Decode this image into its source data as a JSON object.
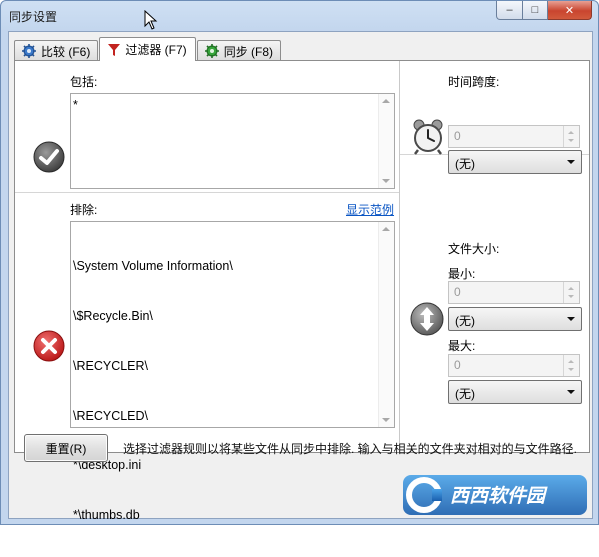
{
  "window": {
    "title": "同步设置",
    "buttons": {
      "minimize": "–",
      "maximize": "□",
      "close": "✕"
    }
  },
  "tabs": [
    {
      "label": "比较 (F6)",
      "icon": "gear-blue-icon",
      "active": false
    },
    {
      "label": "过滤器 (F7)",
      "icon": "funnel-red-icon",
      "active": true
    },
    {
      "label": "同步 (F8)",
      "icon": "gear-green-icon",
      "active": false
    }
  ],
  "include": {
    "label": "包括:",
    "value": "*",
    "icon": "check-circle-icon"
  },
  "exclude": {
    "label": "排除:",
    "show_example_link": "显示范例",
    "lines": [
      "\\System Volume Information\\",
      "\\$Recycle.Bin\\",
      "\\RECYCLER\\",
      "\\RECYCLED\\",
      "*\\desktop.ini",
      "*\\thumbs.db"
    ],
    "icon": "cross-circle-icon"
  },
  "time_span": {
    "label": "时间跨度:",
    "value": "0",
    "unit": "(无)",
    "icon": "alarm-clock-icon"
  },
  "file_size": {
    "label": "文件大小:",
    "min_label": "最小:",
    "min_value": "0",
    "min_unit": "(无)",
    "max_label": "最大:",
    "max_value": "0",
    "max_unit": "(无)",
    "icon": "up-down-arrows-icon"
  },
  "footer": {
    "reset_button": "重置(R)",
    "hint": "选择过滤器规则以将某些文件从同步中排除. 输入与相关的文件夹对相对的与文件路径."
  },
  "watermark": {
    "text": "西西软件园",
    "icon": "logo-c-icon"
  },
  "colors": {
    "link": "#0b56c4",
    "close_button": "#c9452f",
    "exclude_red": "#d93a3a",
    "title_bar": "#c3d6ee"
  }
}
